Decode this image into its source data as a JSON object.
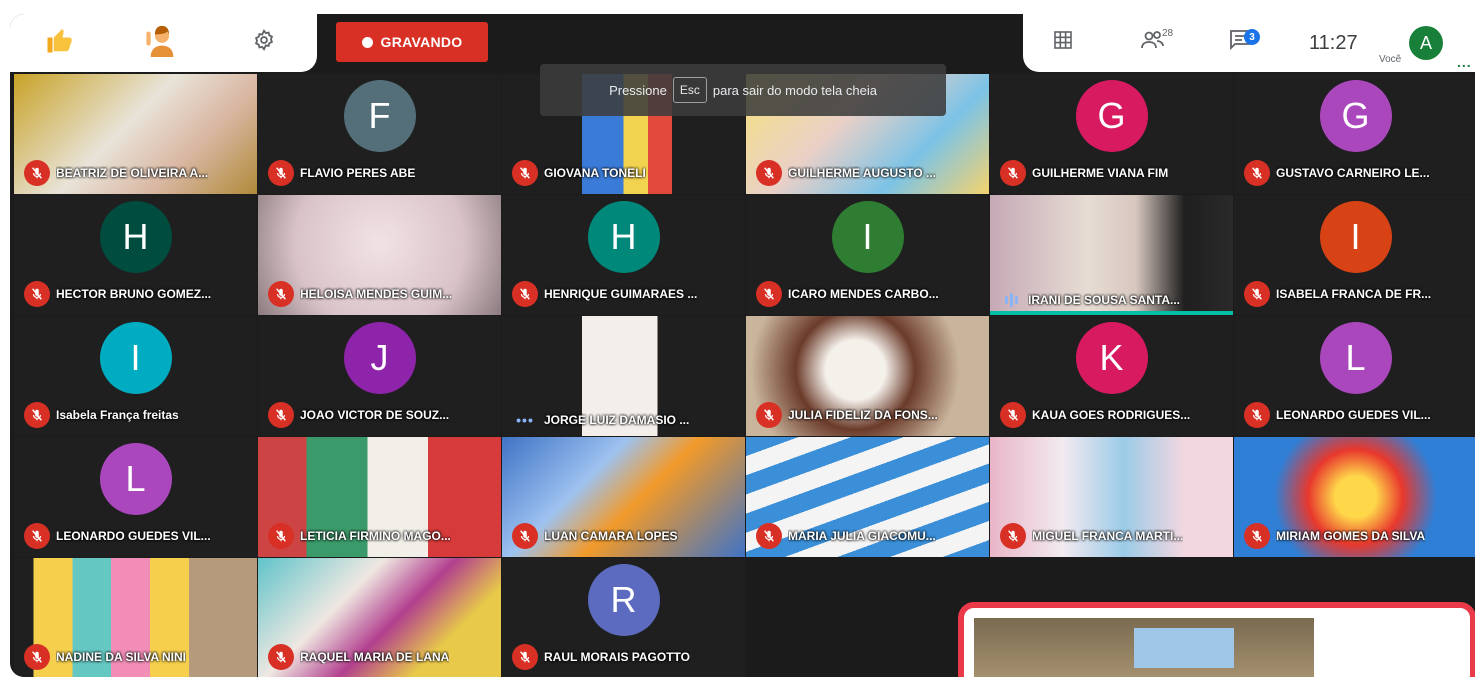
{
  "toolbar": {
    "recording_label": "GRAVANDO",
    "participants_count": "28",
    "chat_unread": "3",
    "clock": "11:27",
    "self_label": "Você",
    "self_initial": "A",
    "more_dots": "..."
  },
  "toast": {
    "before": "Pressione",
    "key": "Esc",
    "after": "para sair do modo tela cheia"
  },
  "tiles": [
    {
      "name": "BEATRIZ DE OLIVEIRA A..."
    },
    {
      "name": "FLAVIO PERES ABE",
      "initial": "F"
    },
    {
      "name": "GIOVANA TONELI"
    },
    {
      "name": "GUILHERME AUGUSTO ..."
    },
    {
      "name": "GUILHERME VIANA FIM",
      "initial": "G"
    },
    {
      "name": "GUSTAVO CARNEIRO LE...",
      "initial": "G"
    },
    {
      "name": "HECTOR BRUNO GOMEZ...",
      "initial": "H"
    },
    {
      "name": "HELOISA MENDES GUIM..."
    },
    {
      "name": "HENRIQUE GUIMARAES ...",
      "initial": "H"
    },
    {
      "name": "ICARO MENDES CARBO...",
      "initial": "I"
    },
    {
      "name": "IRANI DE SOUSA SANTA..."
    },
    {
      "name": "ISABELA FRANCA DE FR...",
      "initial": "I"
    },
    {
      "name": "Isabela França freitas",
      "initial": "I"
    },
    {
      "name": "JOAO VICTOR DE SOUZ...",
      "initial": "J"
    },
    {
      "name": "JORGE LUIZ DAMASIO ..."
    },
    {
      "name": "JULIA FIDELIZ DA FONS..."
    },
    {
      "name": "KAUA GOES RODRIGUES...",
      "initial": "K"
    },
    {
      "name": "LEONARDO GUEDES VIL...",
      "initial": "L"
    },
    {
      "name": "LEONARDO GUEDES VIL...",
      "initial": "L"
    },
    {
      "name": "LETICIA FIRMINO MAGO..."
    },
    {
      "name": "LUAN CAMARA LOPES"
    },
    {
      "name": "MARIA JULIA GIACOMU..."
    },
    {
      "name": "MIGUEL FRANCA MARTI..."
    },
    {
      "name": "MIRIAM GOMES DA SILVA"
    },
    {
      "name": "NADINE DA SILVA NINI"
    },
    {
      "name": "RAQUEL MARIA DE LANA"
    },
    {
      "name": "RAUL MORAIS PAGOTTO",
      "initial": "R"
    }
  ],
  "colors": {
    "recording": "#d93025",
    "self_border": "#ea3a4a",
    "speaking": "#00bfa5"
  }
}
